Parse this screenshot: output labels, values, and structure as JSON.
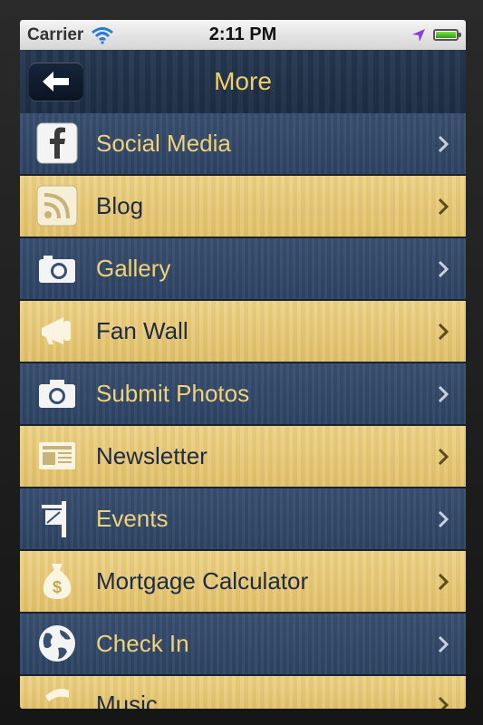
{
  "status_bar": {
    "carrier": "Carrier",
    "time": "2:11 PM"
  },
  "nav": {
    "title": "More"
  },
  "menu": [
    {
      "label": "Social Media",
      "icon": "facebook-icon"
    },
    {
      "label": "Blog",
      "icon": "rss-icon"
    },
    {
      "label": "Gallery",
      "icon": "camera-icon"
    },
    {
      "label": "Fan Wall",
      "icon": "megaphone-icon"
    },
    {
      "label": "Submit Photos",
      "icon": "camera-icon"
    },
    {
      "label": "Newsletter",
      "icon": "newspaper-icon"
    },
    {
      "label": "Events",
      "icon": "sign-icon"
    },
    {
      "label": "Mortgage Calculator",
      "icon": "money-bag-icon"
    },
    {
      "label": "Check In",
      "icon": "globe-icon"
    },
    {
      "label": "Music",
      "icon": "music-icon"
    }
  ],
  "colors": {
    "blue_row": "#2f4565",
    "gold_row": "#e6c774",
    "title": "#f0cf6b"
  }
}
